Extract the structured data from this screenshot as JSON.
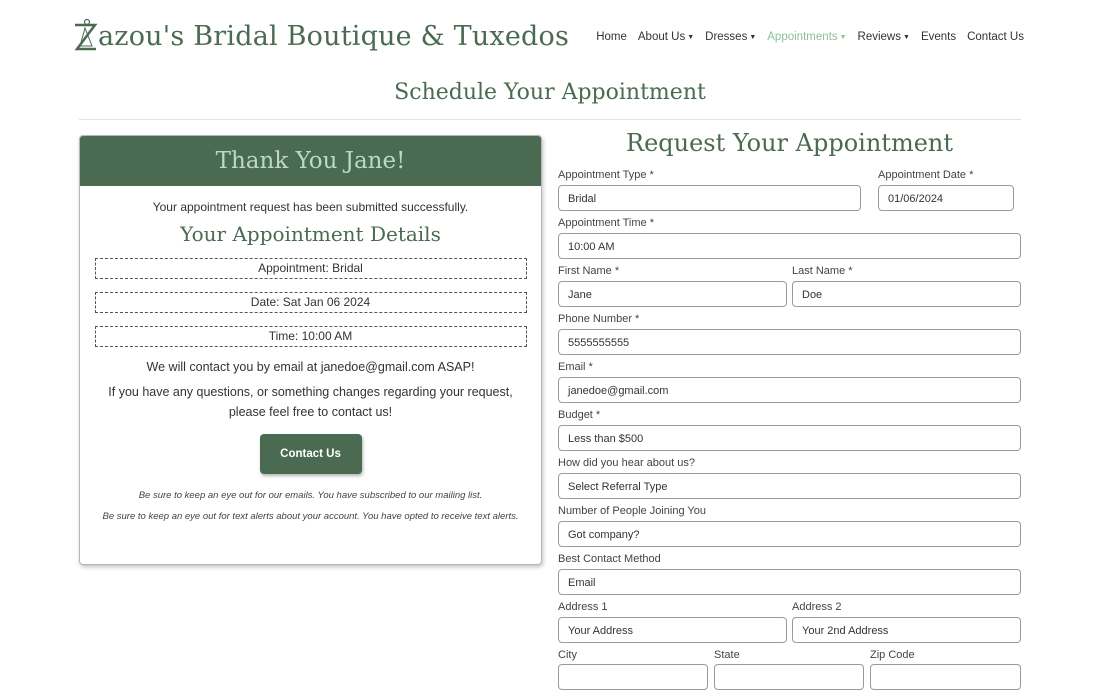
{
  "brand": {
    "name": "Zazou's Bridal Boutique & Tuxedos",
    "first_letter": "Z",
    "rest": "azou's Bridal Boutique & Tuxedos"
  },
  "nav": {
    "home": "Home",
    "about": "About Us",
    "dresses": "Dresses",
    "appointments": "Appointments",
    "reviews": "Reviews",
    "events": "Events",
    "contact": "Contact Us"
  },
  "page_title": "Schedule Your Appointment",
  "card": {
    "header": "Thank You Jane!",
    "message": "Your appointment request has been submitted successfully.",
    "details_title": "Your Appointment Details",
    "appointment": "Appointment: Bridal",
    "date": "Date: Sat Jan 06 2024",
    "time": "Time: 10:00 AM",
    "contact_text": "We will contact you by email at janedoe@gmail.com ASAP!",
    "questions_text": "If you have any questions, or something changes regarding your request, please feel free to contact us!",
    "contact_button": "Contact Us",
    "note_email": "Be sure to keep an eye out for our emails. You have subscribed to our mailing list.",
    "note_text": "Be sure to keep an eye out for text alerts about your account. You have opted to receive text alerts."
  },
  "form": {
    "title": "Request Your Appointment",
    "appointment_type": {
      "label": "Appointment Type *",
      "value": "Bridal"
    },
    "appointment_date": {
      "label": "Appointment Date *",
      "value": "01/06/2024"
    },
    "appointment_time": {
      "label": "Appointment Time *",
      "value": "10:00 AM"
    },
    "first_name": {
      "label": "First Name *",
      "value": "Jane"
    },
    "last_name": {
      "label": "Last Name *",
      "value": "Doe"
    },
    "phone": {
      "label": "Phone Number *",
      "value": "5555555555"
    },
    "email": {
      "label": "Email *",
      "value": "janedoe@gmail.com"
    },
    "budget": {
      "label": "Budget *",
      "value": "Less than $500"
    },
    "referral": {
      "label": "How did you hear about us?",
      "value": "Select Referral Type"
    },
    "people": {
      "label": "Number of People Joining You",
      "placeholder": "Got company?"
    },
    "contact_method": {
      "label": "Best Contact Method",
      "value": "Email"
    },
    "address1": {
      "label": "Address 1",
      "placeholder": "Your Address"
    },
    "address2": {
      "label": "Address 2",
      "placeholder": "Your 2nd Address"
    },
    "city": {
      "label": "City"
    },
    "state": {
      "label": "State"
    },
    "zip": {
      "label": "Zip Code"
    }
  },
  "colors": {
    "brand_green": "#4a6b51",
    "accent_light": "#8cbf98",
    "header_text": "#bcd9c2"
  }
}
